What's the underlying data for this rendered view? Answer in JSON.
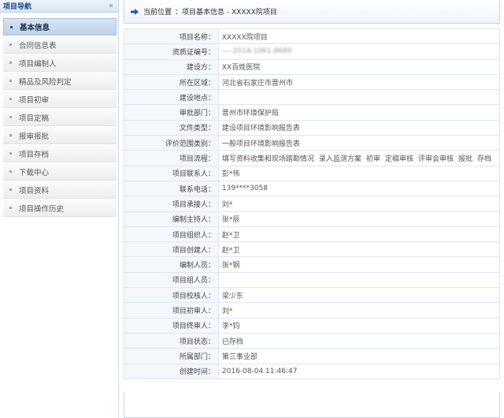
{
  "sidebar": {
    "title": "项目导航",
    "collapse_icon": "«",
    "items": [
      {
        "label": "基本信息",
        "active": true
      },
      {
        "label": "合同信息表",
        "active": false
      },
      {
        "label": "项目编制人",
        "active": false
      },
      {
        "label": "精品及风险判定",
        "active": false
      },
      {
        "label": "项目初审",
        "active": false
      },
      {
        "label": "项目定稿",
        "active": false
      },
      {
        "label": "报审报批",
        "active": false
      },
      {
        "label": "项目存档",
        "active": false
      },
      {
        "label": "下载中心",
        "active": false
      },
      {
        "label": "项目资料",
        "active": false
      },
      {
        "label": "项目操作历史",
        "active": false
      }
    ]
  },
  "breadcrumb": {
    "icon": "arrow-right-icon",
    "label": "当前位置",
    "path": "：项目基本信息 - XXXXX院项目"
  },
  "fields": [
    {
      "key": "项目名称：",
      "value": "XXXXX院项目"
    },
    {
      "key": "资质证编号：",
      "value": "—–2014-1061-8680",
      "blurred": true
    },
    {
      "key": "建设方：",
      "value": "XX百姓医院"
    },
    {
      "key": "所在区域：",
      "value": "河北省石家庄市晋州市"
    },
    {
      "key": "建设地点：",
      "value": ""
    },
    {
      "key": "审批部门：",
      "value": "晋州市环境保护局"
    },
    {
      "key": "文件类型：",
      "value": "建设项目环境影响报告表"
    },
    {
      "key": "评价范围类别：",
      "value": "一般项目环境影响报告表"
    },
    {
      "key": "项目流程：",
      "process": [
        "填写资料收集和现场踏勘情况",
        "录入监测方案",
        "初审",
        "定稿审核",
        "评审会审核",
        "报批",
        "存档"
      ]
    },
    {
      "key": "项目联系人：",
      "value": "彭*伟"
    },
    {
      "key": "联系电话：",
      "value": "139****3058"
    },
    {
      "key": "项目承接人：",
      "value": "刘*"
    },
    {
      "key": "编制主持人：",
      "value": "张*辰"
    },
    {
      "key": "项目组织人：",
      "value": "赵*卫"
    },
    {
      "key": "项目创建人：",
      "value": "赵*卫"
    },
    {
      "key": "编制人员：",
      "value": "张*钢"
    },
    {
      "key": "项目组人员：",
      "value": ""
    },
    {
      "key": "项目校核人：",
      "value": "梁少东"
    },
    {
      "key": "项目初审人：",
      "value": "刘*"
    },
    {
      "key": "项目终审人：",
      "value": "李*钧"
    },
    {
      "key": "项目状态：",
      "value": "已存档"
    },
    {
      "key": "所属部门：",
      "value": "第三事业部"
    },
    {
      "key": "创建时间：",
      "value": "2016-08-04 11:46:47"
    }
  ],
  "colors": {
    "accent": "#1e5ba8",
    "header_bg": "#d9e6f4",
    "key_bg": "#f4f7fb"
  }
}
